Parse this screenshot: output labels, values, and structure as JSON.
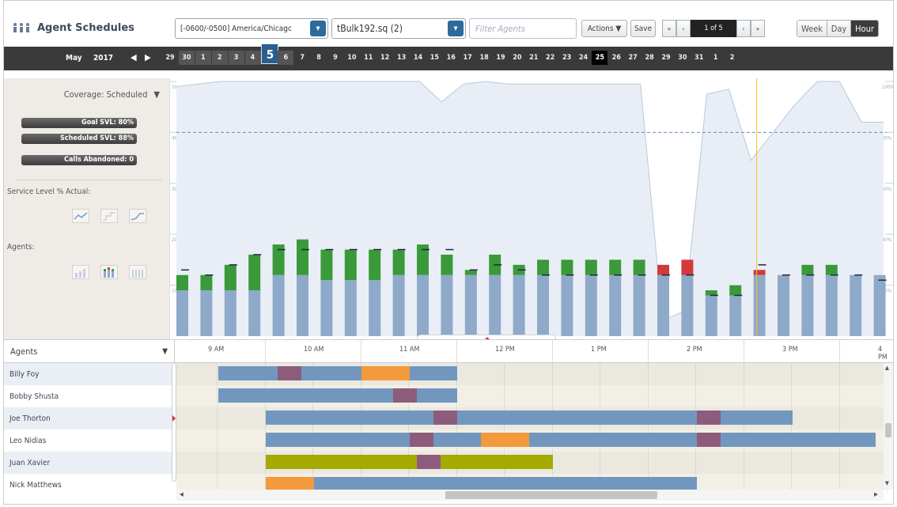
{
  "app": {
    "title": "Agent Schedules",
    "icon": "agents-icon"
  },
  "toolbar": {
    "timezone": "[-0600/-0500] America/Chicagc",
    "queue": "tBulk192.sq (2)",
    "filter_placeholder": "Filter Agents",
    "actions_label": "Actions ▼",
    "save_label": "Save",
    "pager": {
      "first": "«",
      "prev": "‹",
      "info": "1 of 5",
      "next": "›",
      "last": "»"
    },
    "views": [
      "Week",
      "Day",
      "Hour"
    ],
    "active_view": "Hour"
  },
  "datestrip": {
    "month": "May",
    "year": "2017",
    "prev_icon": "◀",
    "next_icon": "▶",
    "days": [
      "29",
      "30",
      "1",
      "2",
      "3",
      "4",
      "5",
      "6",
      "7",
      "8",
      "9",
      "10",
      "11",
      "12",
      "13",
      "14",
      "15",
      "16",
      "17",
      "18",
      "19",
      "20",
      "21",
      "22",
      "23",
      "24",
      "25",
      "26",
      "27",
      "28",
      "29",
      "30",
      "31",
      "1",
      "2"
    ],
    "selected_day": "5",
    "today": "25"
  },
  "left_panel": {
    "coverage_label": "Coverage: Scheduled",
    "goal_svl": "Goal SVL: 80%",
    "scheduled_svl": "Scheduled SVL: 88%",
    "calls_abandoned": "Calls Abandoned: 0",
    "service_level_label": "Service Level % Actual:",
    "agents_label": "Agents:"
  },
  "chart_data": {
    "type": "bar",
    "y_left_ticks": [
      "50",
      "40",
      "30",
      "20",
      "10"
    ],
    "y_right_ticks": [
      "100%",
      "80%",
      "60%",
      "40%",
      "20%"
    ],
    "ylim": [
      0,
      50
    ],
    "series": [
      {
        "values": [
          9,
          9,
          9,
          9,
          12,
          12,
          11,
          11,
          11,
          12,
          12,
          12,
          12,
          12,
          12,
          12,
          12,
          12,
          12,
          12,
          12,
          12,
          8,
          8,
          12,
          12,
          12,
          12,
          12,
          12,
          12,
          13,
          13
        ]
      },
      {
        "values": [
          3,
          3,
          5,
          7,
          6,
          7,
          6,
          6,
          6,
          5,
          6,
          4,
          1,
          4,
          2,
          3,
          3,
          3,
          3,
          3,
          -2,
          -3,
          1,
          2,
          -1,
          0,
          2,
          2,
          0,
          0
        ]
      },
      {
        "values": [
          13,
          12,
          14,
          16,
          17,
          17,
          17,
          17,
          17,
          17,
          17,
          17,
          13,
          14,
          13,
          12,
          12,
          12,
          12,
          12,
          12,
          12,
          8,
          8,
          14,
          12,
          12,
          12,
          12,
          11,
          11,
          13,
          13
        ]
      }
    ],
    "coverage_line": [
      98,
      99,
      100,
      100,
      100,
      100,
      100,
      100,
      100,
      100,
      100,
      100,
      92,
      99,
      100,
      99,
      99,
      99,
      99,
      99,
      99,
      99,
      6,
      10,
      95,
      97,
      69,
      80,
      91,
      100,
      100,
      84,
      84
    ],
    "goal_line": 80
  },
  "timeline": {
    "agents_header": "Agents",
    "hours": [
      "9 AM",
      "10 AM",
      "11 AM",
      "12 PM",
      "1 PM",
      "2 PM",
      "3 PM",
      "4 PM"
    ],
    "agents": [
      {
        "name": "Billy Foy",
        "blocks": [
          {
            "type": "blue",
            "start": 0.5,
            "end": 1.12
          },
          {
            "type": "purple",
            "start": 1.12,
            "end": 1.37
          },
          {
            "type": "blue",
            "start": 1.37,
            "end": 2.0
          },
          {
            "type": "orange",
            "start": 2.0,
            "end": 2.5
          },
          {
            "type": "blue",
            "start": 2.5,
            "end": 3.0
          }
        ]
      },
      {
        "name": "Bobby Shusta",
        "blocks": [
          {
            "type": "blue",
            "start": 0.5,
            "end": 2.33
          },
          {
            "type": "purple",
            "start": 2.33,
            "end": 2.58
          },
          {
            "type": "blue",
            "start": 2.58,
            "end": 3.0
          }
        ]
      },
      {
        "name": "Joe Thorton",
        "blocks": [
          {
            "type": "blue",
            "start": 1.0,
            "end": 2.75
          },
          {
            "type": "purple",
            "start": 2.75,
            "end": 3.0
          },
          {
            "type": "blue",
            "start": 3.0,
            "end": 5.5
          },
          {
            "type": "purple",
            "start": 5.5,
            "end": 5.75
          },
          {
            "type": "blue",
            "start": 5.75,
            "end": 6.5
          }
        ]
      },
      {
        "name": "Leo Nidias",
        "blocks": [
          {
            "type": "blue",
            "start": 1.0,
            "end": 2.5
          },
          {
            "type": "purple",
            "start": 2.5,
            "end": 2.75
          },
          {
            "type": "blue",
            "start": 2.75,
            "end": 3.25
          },
          {
            "type": "orange",
            "start": 3.25,
            "end": 3.75
          },
          {
            "type": "blue",
            "start": 3.75,
            "end": 5.5
          },
          {
            "type": "purple",
            "start": 5.5,
            "end": 5.75
          },
          {
            "type": "blue",
            "start": 5.75,
            "end": 7.37
          }
        ]
      },
      {
        "name": "Juan Xavier",
        "blocks": [
          {
            "type": "olive",
            "start": 1.0,
            "end": 2.58
          },
          {
            "type": "purple",
            "start": 2.58,
            "end": 2.83
          },
          {
            "type": "olive",
            "start": 2.83,
            "end": 4.0
          }
        ]
      },
      {
        "name": "Nick Matthews",
        "blocks": [
          {
            "type": "orange",
            "start": 1.0,
            "end": 1.5
          },
          {
            "type": "blue",
            "start": 1.5,
            "end": 5.5
          }
        ]
      }
    ]
  },
  "colors": {
    "scheduled": "#8fa9c9",
    "over": "#3a9a3a",
    "under": "#d23a3a",
    "coverage_area": "#e9eef6",
    "goal": "#5b8fc9",
    "now": "#f0c419"
  }
}
